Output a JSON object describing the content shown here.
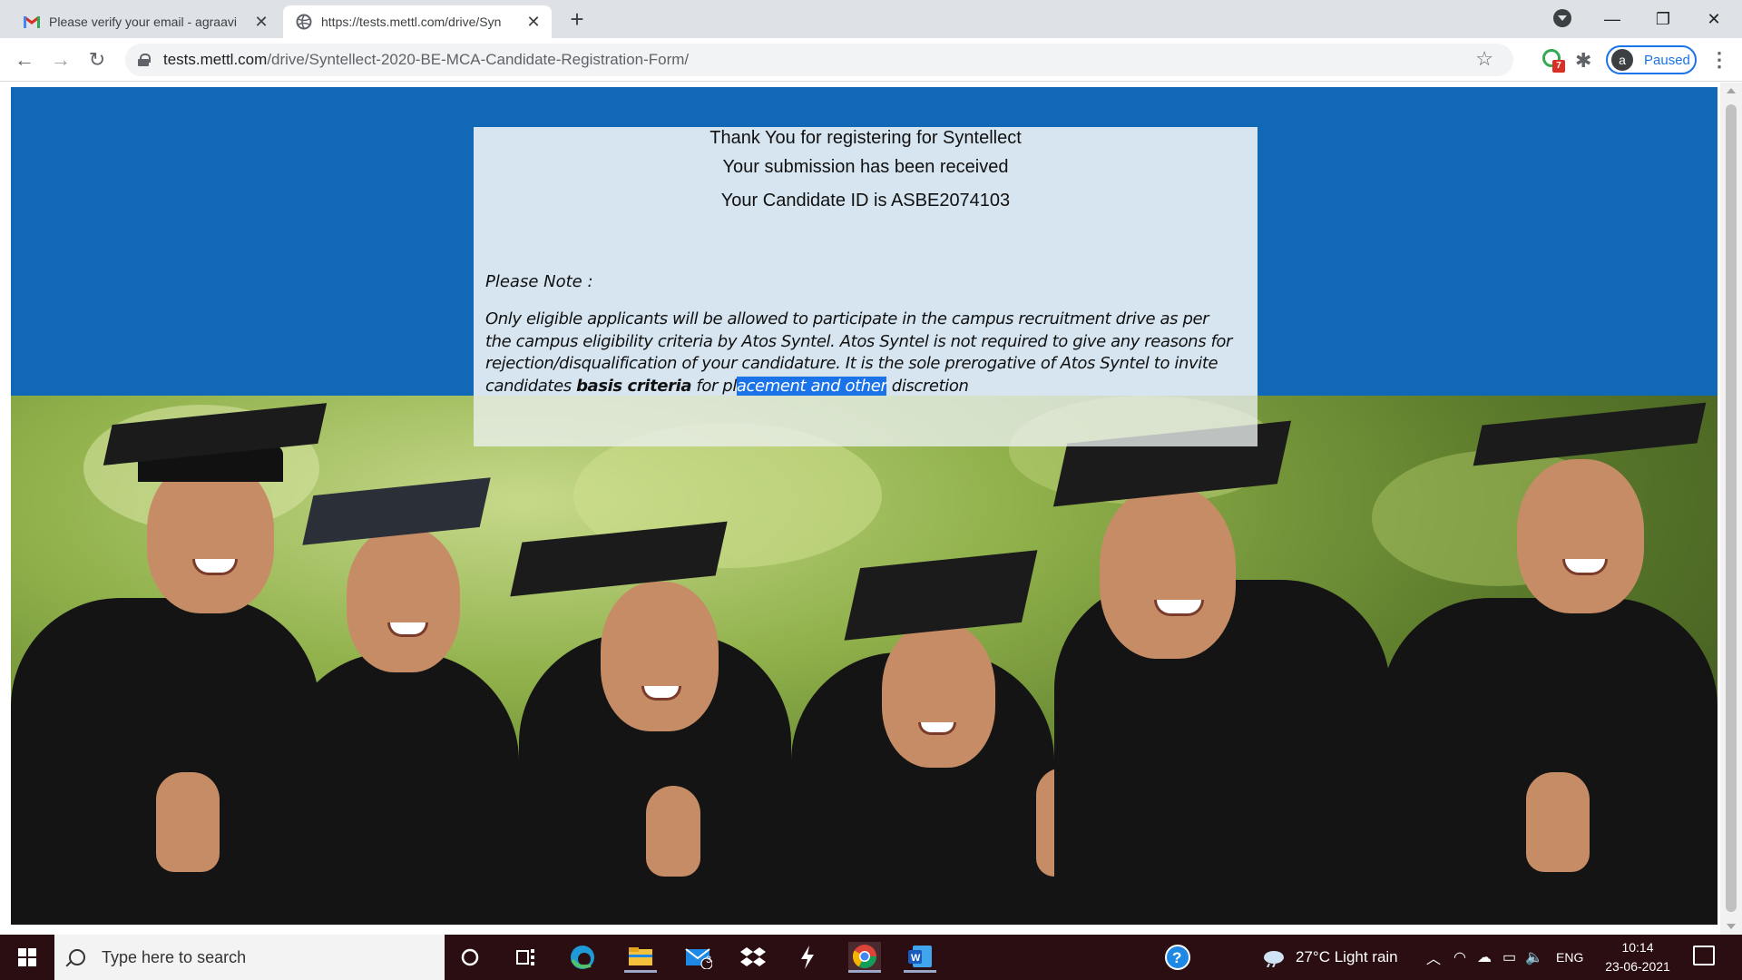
{
  "browser": {
    "tabs": [
      {
        "title": "Please verify your email - agraavi",
        "active": false,
        "icon": "gmail-icon"
      },
      {
        "title": "https://tests.mettl.com/drive/Syn",
        "active": true,
        "icon": "globe-icon"
      }
    ],
    "new_tab_label": "+",
    "url_host": "tests.mettl.com",
    "url_path": "/drive/Syntellect-2020-BE-MCA-Candidate-Registration-Form/",
    "extension_badge_count": "7",
    "profile_initial": "a",
    "profile_status": "Paused"
  },
  "page": {
    "thank_you": "Thank You for registering for Syntellect",
    "submission": "Your submission has been received",
    "candidate_id": "Your Candidate ID is ASBE2074103",
    "note_title": "Please Note :",
    "note_part1": "Only eligible applicants will be allowed to participate in the campus recruitment drive as per the campus eligibility criteria by Atos Syntel.  Atos Syntel is not required to give any reasons for rejection/disqualification of your candidature. It is the sole prerogative of Atos Syntel to invite candidates ",
    "note_bold": "basis criteria",
    "note_part2": " for pl",
    "note_selected": "acement and other",
    "note_part3": " discretion",
    "colors": {
      "banner": "#1168b6",
      "card": "#d6e5f0",
      "selection": "#1a73e8"
    }
  },
  "taskbar": {
    "search_placeholder": "Type here to search",
    "mail_badge": "3",
    "weather": "27°C  Light rain",
    "language": "ENG",
    "time": "10:14",
    "date": "23-06-2021"
  }
}
